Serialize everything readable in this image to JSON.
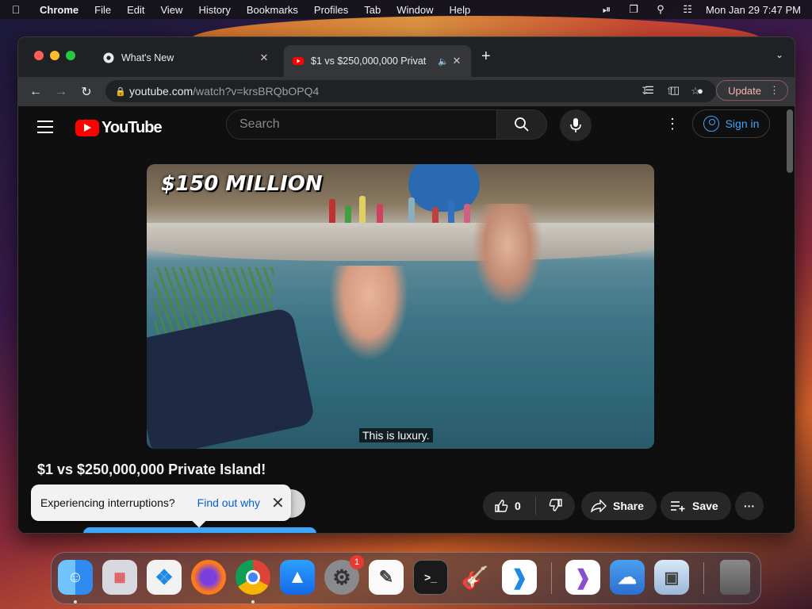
{
  "menubar": {
    "app": "Chrome",
    "items": [
      "File",
      "Edit",
      "View",
      "History",
      "Bookmarks",
      "Profiles",
      "Tab",
      "Window",
      "Help"
    ],
    "clock": "Mon Jan 29  7:47 PM"
  },
  "tabs": [
    {
      "title": "What's New",
      "icon": "chrome-icon"
    },
    {
      "title": "$1 vs $250,000,000 Privat",
      "icon": "youtube-icon",
      "active": true
    }
  ],
  "omnibox": {
    "host": "youtube.com",
    "path": "/watch?v=krsBRQbOPQ4"
  },
  "toolbar": {
    "update_label": "Update"
  },
  "youtube": {
    "logo_text": "YouTube",
    "search_placeholder": "Search",
    "signin_label": "Sign in",
    "video": {
      "overlay_text": "$150 MILLION",
      "caption": "This is luxury."
    },
    "title": "$1 vs $250,000,000 Private Island!",
    "like_count": "0",
    "share_label": "Share",
    "save_label": "Save",
    "toast": {
      "message": "Experiencing interruptions?",
      "link": "Find out why"
    }
  },
  "dock": {
    "apps": [
      "Finder",
      "Launchpad",
      "Safari",
      "Firefox",
      "Chrome",
      "App Store",
      "System Settings",
      "TextEdit",
      "Terminal",
      "GarageBand",
      "Visual Studio Code",
      "Visual Studio",
      "Weather",
      "Preview",
      "Trash"
    ],
    "settings_badge": "1"
  }
}
